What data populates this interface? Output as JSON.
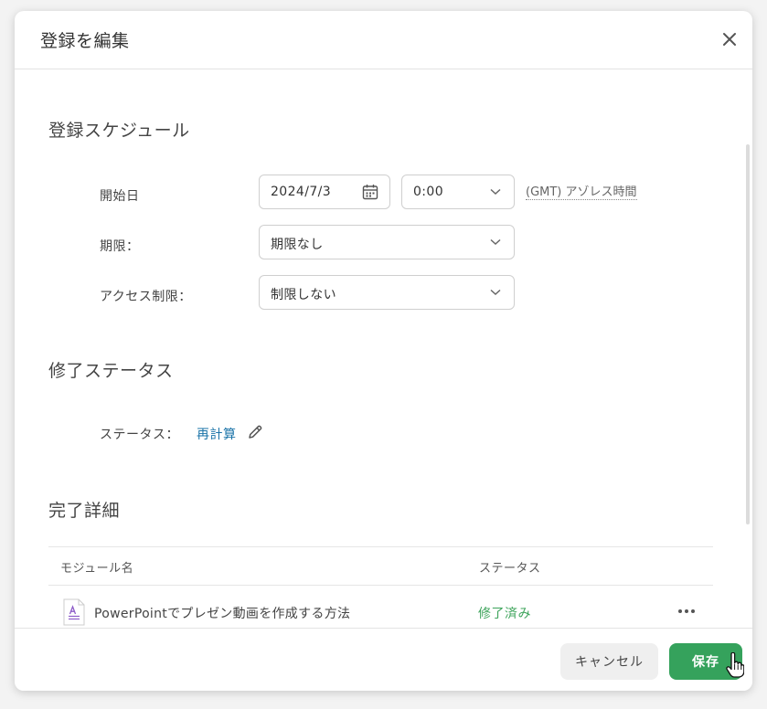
{
  "dialog": {
    "title": "登録を編集"
  },
  "schedule": {
    "section_title": "登録スケジュール",
    "start_label": "開始日",
    "start_date": "2024/7/3",
    "start_time": "0:00",
    "timezone": "(GMT) アゾレス時間",
    "deadline_label": "期限：",
    "deadline_value": "期限なし",
    "access_label": "アクセス制限：",
    "access_value": "制限しない"
  },
  "completion_status": {
    "section_title": "修了ステータス",
    "status_label": "ステータス：",
    "status_value": "再計算"
  },
  "completion_details": {
    "section_title": "完了詳細",
    "columns": [
      "モジュール名",
      "ステータス"
    ],
    "rows": [
      {
        "module": "PowerPointでプレゼン動画を作成する方法",
        "status": "修了済み"
      }
    ]
  },
  "footer": {
    "cancel_label": "キャンセル",
    "save_label": "保存"
  },
  "colors": {
    "accent_green": "#35a25c",
    "link_blue": "#1a73a8",
    "status_green": "#3ca35a"
  },
  "icons": {
    "close": "close-icon",
    "calendar": "calendar-icon",
    "chevron": "chevron-down-icon",
    "pencil": "pencil-icon",
    "file": "document-icon",
    "more": "more-horizontal-icon",
    "cursor": "hand-pointer-icon"
  }
}
